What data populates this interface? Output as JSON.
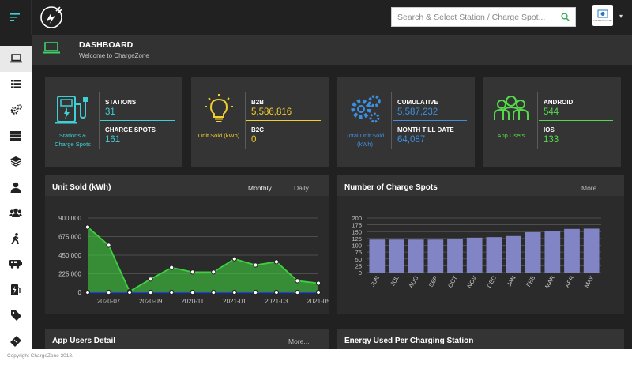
{
  "header": {
    "search_placeholder": "Search & Select Station / Charge Spot...",
    "search_icon": "search-icon",
    "menu_icon": "hamburger-icon",
    "brand_icon": "chargezone-plug-logo",
    "partner_logo_text": "COMPANY NAME"
  },
  "sidebar": {
    "icons": [
      "laptop-icon",
      "list-icon",
      "gears-icon",
      "server-icon",
      "layers-icon",
      "user-tie-icon",
      "users-icon",
      "walking-icon",
      "bus-icon",
      "fuel-icon",
      "tag-icon",
      "ticket-icon"
    ]
  },
  "page": {
    "title": "DASHBOARD",
    "subtitle": "Welcome to ChargeZone"
  },
  "cards": [
    {
      "name_line1": "Stations &",
      "name_line2": "Charge Spots",
      "color": "#3fcfd6",
      "stat1_label": "STATIONS",
      "stat1_value": "31",
      "stat2_label": "CHARGE SPOTS",
      "stat2_value": "161"
    },
    {
      "name_line1": "Unit Sold (kWh)",
      "color": "#f0cf2e",
      "stat1_label": "B2B",
      "stat1_value": "5,586,816",
      "stat2_label": "B2C",
      "stat2_value": "0"
    },
    {
      "name_line1": "Total Unit Sold",
      "name_line2": "(kWh)",
      "color": "#3d8fe0",
      "stat1_label": "CUMULATIVE",
      "stat1_value": "5,587,232",
      "stat2_label": "MONTH TILL DATE",
      "stat2_value": "64,087"
    },
    {
      "name_line1": "App Users",
      "color": "#55d94a",
      "stat1_label": "ANDROID",
      "stat1_value": "544",
      "stat2_label": "IOS",
      "stat2_value": "133"
    }
  ],
  "panels": {
    "unit_sold": {
      "title": "Unit Sold (kWh)",
      "tab_monthly": "Monthly",
      "tab_daily": "Daily"
    },
    "charge_spots": {
      "title": "Number of Charge Spots",
      "more": "More..."
    },
    "app_users": {
      "title": "App Users Detail",
      "more": "More..."
    },
    "energy": {
      "title": "Energy Used Per Charging Station"
    }
  },
  "chart_data": [
    {
      "type": "area",
      "title": "Unit Sold (kWh)",
      "x": [
        "2020-06",
        "2020-07",
        "2020-08",
        "2020-09",
        "2020-10",
        "2020-11",
        "2020-12",
        "2021-01",
        "2021-02",
        "2021-03",
        "2021-04",
        "2021-05"
      ],
      "x_tick_labels": [
        "2020-07",
        "2020-09",
        "2020-11",
        "2021-01",
        "2021-03",
        "2021-05"
      ],
      "y_tick_labels": [
        "0",
        "225,000",
        "450,000",
        "675,000",
        "900,000"
      ],
      "ylim": [
        0,
        900000
      ],
      "series": [
        {
          "values": [
            790000,
            570000,
            10000,
            160000,
            300000,
            245000,
            245000,
            405000,
            330000,
            370000,
            140000,
            110000
          ],
          "color": "#3ecf3e"
        },
        {
          "values": [
            0,
            0,
            0,
            0,
            0,
            0,
            0,
            0,
            0,
            0,
            0,
            0
          ],
          "color": "#1f43d6"
        }
      ],
      "grid": true
    },
    {
      "type": "bar",
      "title": "Number of Charge Spots",
      "categories": [
        "JUN",
        "JUL",
        "AUG",
        "SEP",
        "OCT",
        "NOV",
        "DEC",
        "JAN",
        "FEB",
        "MAR",
        "APR",
        "MAY"
      ],
      "values": [
        121,
        121,
        121,
        121,
        123,
        128,
        130,
        134,
        148,
        153,
        160,
        161
      ],
      "y_tick_labels": [
        "0",
        "25",
        "50",
        "75",
        "100",
        "125",
        "150",
        "175",
        "200"
      ],
      "ylim": [
        0,
        200
      ],
      "color": "#8185c6",
      "grid": true
    }
  ],
  "footer": {
    "copyright": "Copyright ChargeZone 2018."
  }
}
